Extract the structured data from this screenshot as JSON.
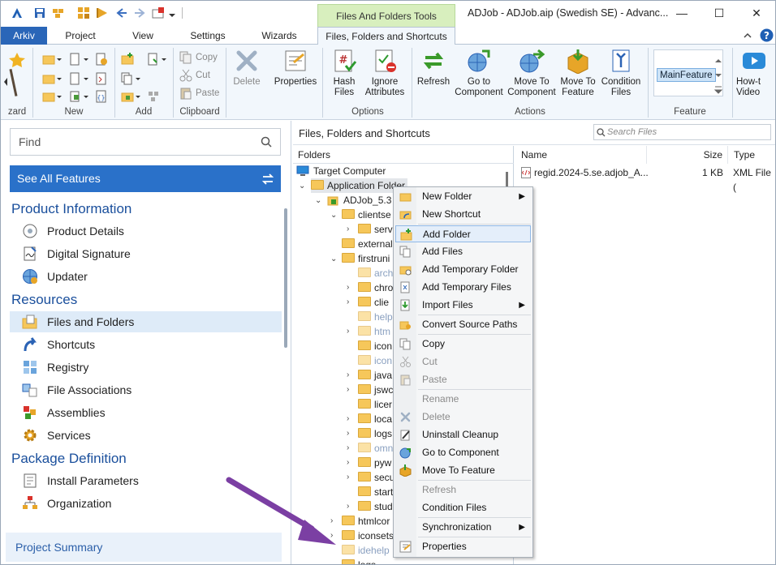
{
  "window": {
    "title": "ADJob - ADJob.aip (Swedish SE) - Advanc...",
    "context_tab_header": "Files And Folders Tools",
    "controls": {
      "minimize": "—",
      "maximize": "☐",
      "close": "✕"
    }
  },
  "tabs": [
    "Arkiv",
    "Project",
    "View",
    "Settings",
    "Wizards",
    "Files, Folders and Shortcuts"
  ],
  "ribbon": {
    "groups": {
      "wizard": "zard",
      "new": "New",
      "add": "Add",
      "clipboard": "Clipboard",
      "options": "Options",
      "actions": "Actions",
      "feature": "Feature"
    },
    "clipboard": {
      "copy": "Copy",
      "cut": "Cut",
      "paste": "Paste"
    },
    "delete": "Delete",
    "properties": "Properties",
    "hash_files": [
      "Hash",
      "Files"
    ],
    "ignore_attributes": [
      "Ignore",
      "Attributes"
    ],
    "refresh": "Refresh",
    "go_to_component": [
      "Go to",
      "Component"
    ],
    "move_to_component": [
      "Move To",
      "Component"
    ],
    "move_to_feature": [
      "Move To",
      "Feature"
    ],
    "condition_files": [
      "Condition",
      "Files"
    ],
    "feature_selected": "MainFeature",
    "how_to_video": [
      "How-t",
      "Video"
    ]
  },
  "left_panel": {
    "find_placeholder": "Find",
    "see_all": "See All Features",
    "sections": [
      {
        "title": "Product Information",
        "items": [
          "Product Details",
          "Digital Signature",
          "Updater"
        ]
      },
      {
        "title": "Resources",
        "items": [
          "Files and Folders",
          "Shortcuts",
          "Registry",
          "File Associations",
          "Assemblies",
          "Services"
        ]
      },
      {
        "title": "Package Definition",
        "items": [
          "Install Parameters",
          "Organization"
        ]
      }
    ],
    "project_summary": "Project Summary"
  },
  "pane": {
    "title": "Files, Folders and Shortcuts",
    "search_placeholder": "Search Files",
    "folders_header": "Folders",
    "columns": {
      "name": "Name",
      "size": "Size",
      "type": "Type"
    },
    "file": {
      "name": "regid.2024-5.se.adjob_A...",
      "size": "1 KB",
      "type": "XML File ("
    }
  },
  "tree": {
    "target": "Target Computer",
    "app_folder": "Application Folder",
    "adjob": "ADJob_5.3",
    "nodes": [
      "clientse",
      "serv",
      "external",
      "firstruni",
      "arch",
      "chro",
      "clie",
      "help",
      "htm",
      "icon",
      "icon",
      "java",
      "jswc",
      "licer",
      "loca",
      "logs",
      "omn",
      "pyw",
      "secu",
      "start",
      "stud",
      "htmlcor",
      "iconsets",
      "idehelp",
      "logs"
    ]
  },
  "context_menu": {
    "items": [
      "New Folder",
      "New Shortcut",
      "Add Folder",
      "Add Files",
      "Add Temporary Folder",
      "Add Temporary Files",
      "Import Files",
      "Convert Source Paths",
      "Copy",
      "Cut",
      "Paste",
      "Rename",
      "Delete",
      "Uninstall Cleanup",
      "Go to Component",
      "Move To Feature",
      "Refresh",
      "Condition Files",
      "Synchronization",
      "Properties"
    ]
  }
}
